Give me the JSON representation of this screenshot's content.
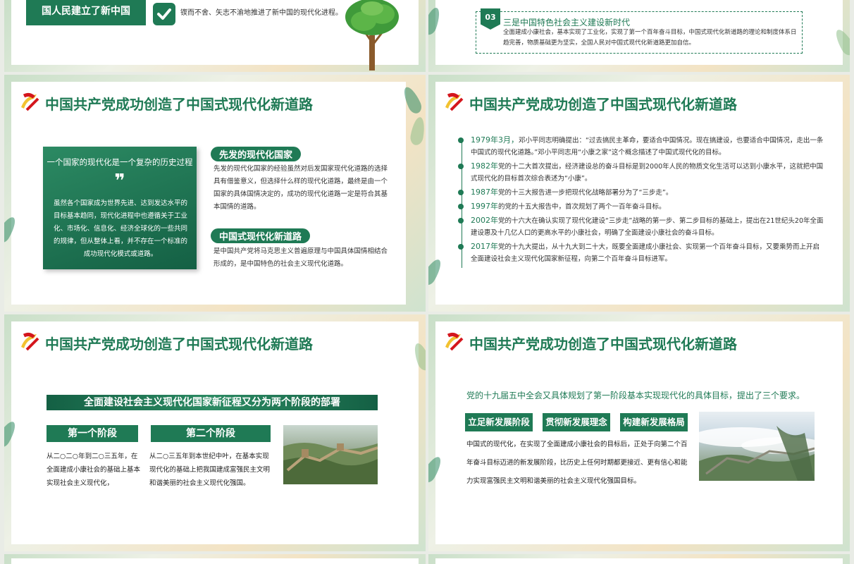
{
  "top_left": {
    "banner": "国人民建立了新中国",
    "text": "锲而不舍、矢志不渝地推进了新中国的现代化进程。"
  },
  "top_right": {
    "number": "03",
    "heading": "三是中国特色社会主义建设新时代",
    "body": "全面建成小康社会，基本实现了工业化，实现了第一个百年奋斗目标，中国式现代化新道路的理论和制度体系日趋完善，物质基础更为坚实，全国人民对中国式现代化新道路更加自信。"
  },
  "slide_title": "中国共产党成功创造了中国式现代化新道路",
  "mid_left": {
    "quote_title": "一个国家的现代化是一个复杂的历史过程",
    "quote_mark": "❞",
    "quote_body": "虽然各个国家成为世界先进、达到发达水平的目标基本趋同，现代化进程中也遵循关于工业化、市场化、信息化、经济全球化的一些共同的规律，但从整体上看，并不存在一个标准的成功现代化模式或道路。",
    "tag1": "先发的现代化国家",
    "text1": "先发的现代化国家的经验虽然对后发国家现代化道路的选择具有借鉴意义，但选择什么样的现代化道路，最终是由一个国家的具体国情决定的，成功的现代化道路一定是符合其基本国情的道路。",
    "tag2": "中国式现代化新道路",
    "text2": "是中国共产党将马克思主义普遍原理与中国具体国情相结合形成的，是中国特色的社会主义现代化道路。"
  },
  "mid_right": {
    "items": [
      {
        "year": "1979年3月，",
        "text": "邓小平同志明确提出：“过去搞民主革命，要适合中国情况。现在搞建设，也要适合中国情况，走出一条中国式的现代化道路。”邓小平同志用“小康之家”这个概念描述了中国式现代化的目标。"
      },
      {
        "year": "1982年",
        "text": "党的十二大首次提出，经济建设总的奋斗目标是到2000年人民的物质文化生活可以达到小康水平，这就把中国式现代化的目标首次综合表述为“小康”。"
      },
      {
        "year": "1987年",
        "text": "党的十三大报告进一步把现代化战略部署分为了“三步走”。"
      },
      {
        "year": "1997年",
        "text": "的党的十五大报告中，首次规划了两个一百年奋斗目标。"
      },
      {
        "year": "2002年",
        "text": "党的十六大在确认实现了现代化建设“三步走”战略的第一步、第二步目标的基础上，提出在21世纪头20年全面建设惠及十几亿人口的更高水平的小康社会，明确了全面建设小康社会的奋斗目标。"
      },
      {
        "year": "2017年",
        "text": "党的十九大提出，从十九大到二十大，既要全面建成小康社会、实现第一个百年奋斗目标，又要乘势而上开启全面建设社会主义现代化国家新征程，向第二个百年奋斗目标进军。"
      }
    ]
  },
  "bot_left": {
    "main_bar": "全面建设社会主义现代化国家新征程又分为两个阶段的部署",
    "stage1": "第一个阶段",
    "stage1_text": "从二○二○年到二○三五年，在全面建成小康社会的基础上基本实现社会主义现代化，",
    "stage2": "第二个阶段",
    "stage2_text": "从二○三五年到本世纪中叶，在基本实现现代化的基础上把我国建成富强民主文明和谐美丽的社会主义现代化强国。"
  },
  "bot_right": {
    "lead": "党的十九届五中全会又具体规划了第一阶段基本实现现代化的具体目标，提出了三个要求。",
    "tags": [
      "立足新发展阶段",
      "贯彻新发展理念",
      "构建新发展格局"
    ],
    "body": "中国式的现代化，在实现了全面建成小康社会的目标后，正处于向第二个百年奋斗目标迈进的新发展阶段，比历史上任何时期都更接近、更有信心和能力实现富强民主文明和谐美丽的社会主义现代化强国目标。"
  },
  "colors": {
    "accent": "#1f7a55",
    "dark_green": "#146044",
    "red": "#c8161d",
    "gold": "#f2c230"
  },
  "icons": [
    "check-icon",
    "tree-icon",
    "party-emblem-icon",
    "quote-icon",
    "great-wall-photo"
  ]
}
